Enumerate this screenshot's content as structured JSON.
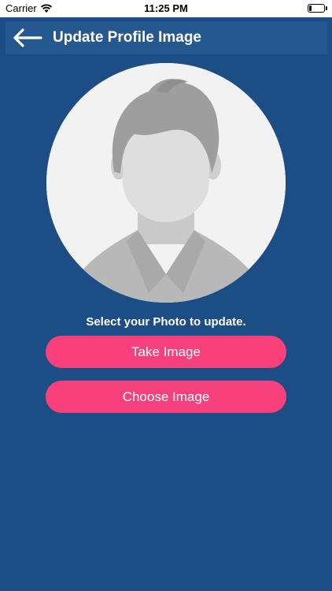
{
  "status_bar": {
    "carrier": "Carrier",
    "time": "11:25 PM",
    "battery_level": 0.2
  },
  "header": {
    "back_icon": "arrow-left-icon",
    "title": "Update Profile Image"
  },
  "main": {
    "avatar_icon": "default-user-silhouette",
    "prompt": "Select your Photo to update.",
    "take_image_label": "Take Image",
    "choose_image_label": "Choose Image"
  },
  "colors": {
    "background": "#1c4d85",
    "header_bar": "#25588f",
    "button": "#f8417c",
    "avatar_bg": "#f2f2f2"
  }
}
